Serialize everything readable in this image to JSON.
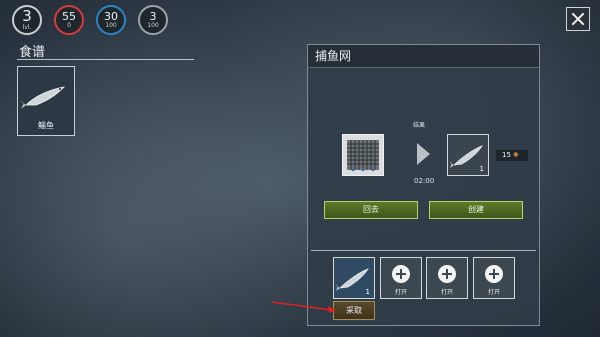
{
  "hud": {
    "level": {
      "value": "3",
      "label": "lvl."
    },
    "health": {
      "value": "55",
      "sub": "0"
    },
    "water": {
      "value": "30",
      "sub": "100"
    },
    "food": {
      "value": "3",
      "sub": "100"
    }
  },
  "recipes": {
    "title": "食谱",
    "items": [
      {
        "label": "鲻鱼",
        "icon": "fish-icon"
      }
    ]
  },
  "panel": {
    "title": "捕鱼网",
    "status_label": "结果",
    "timer": "02:00",
    "input_icon": "fishing-net-icon",
    "output": {
      "icon": "fish-icon",
      "count": "1"
    },
    "xp": {
      "value": "15",
      "icon": "spark-icon"
    },
    "back_button": "回去",
    "create_button": "创建",
    "storage": {
      "filled": {
        "icon": "fish-icon",
        "count": "1"
      },
      "empty_slots": [
        {
          "label": "打开"
        },
        {
          "label": "打开"
        },
        {
          "label": "打开"
        }
      ]
    },
    "harvest_button": "采取"
  },
  "colors": {
    "health": "#d63a3a",
    "water": "#2a86c7",
    "button_green": "#5f7a2a",
    "pointer": "#e02020"
  }
}
